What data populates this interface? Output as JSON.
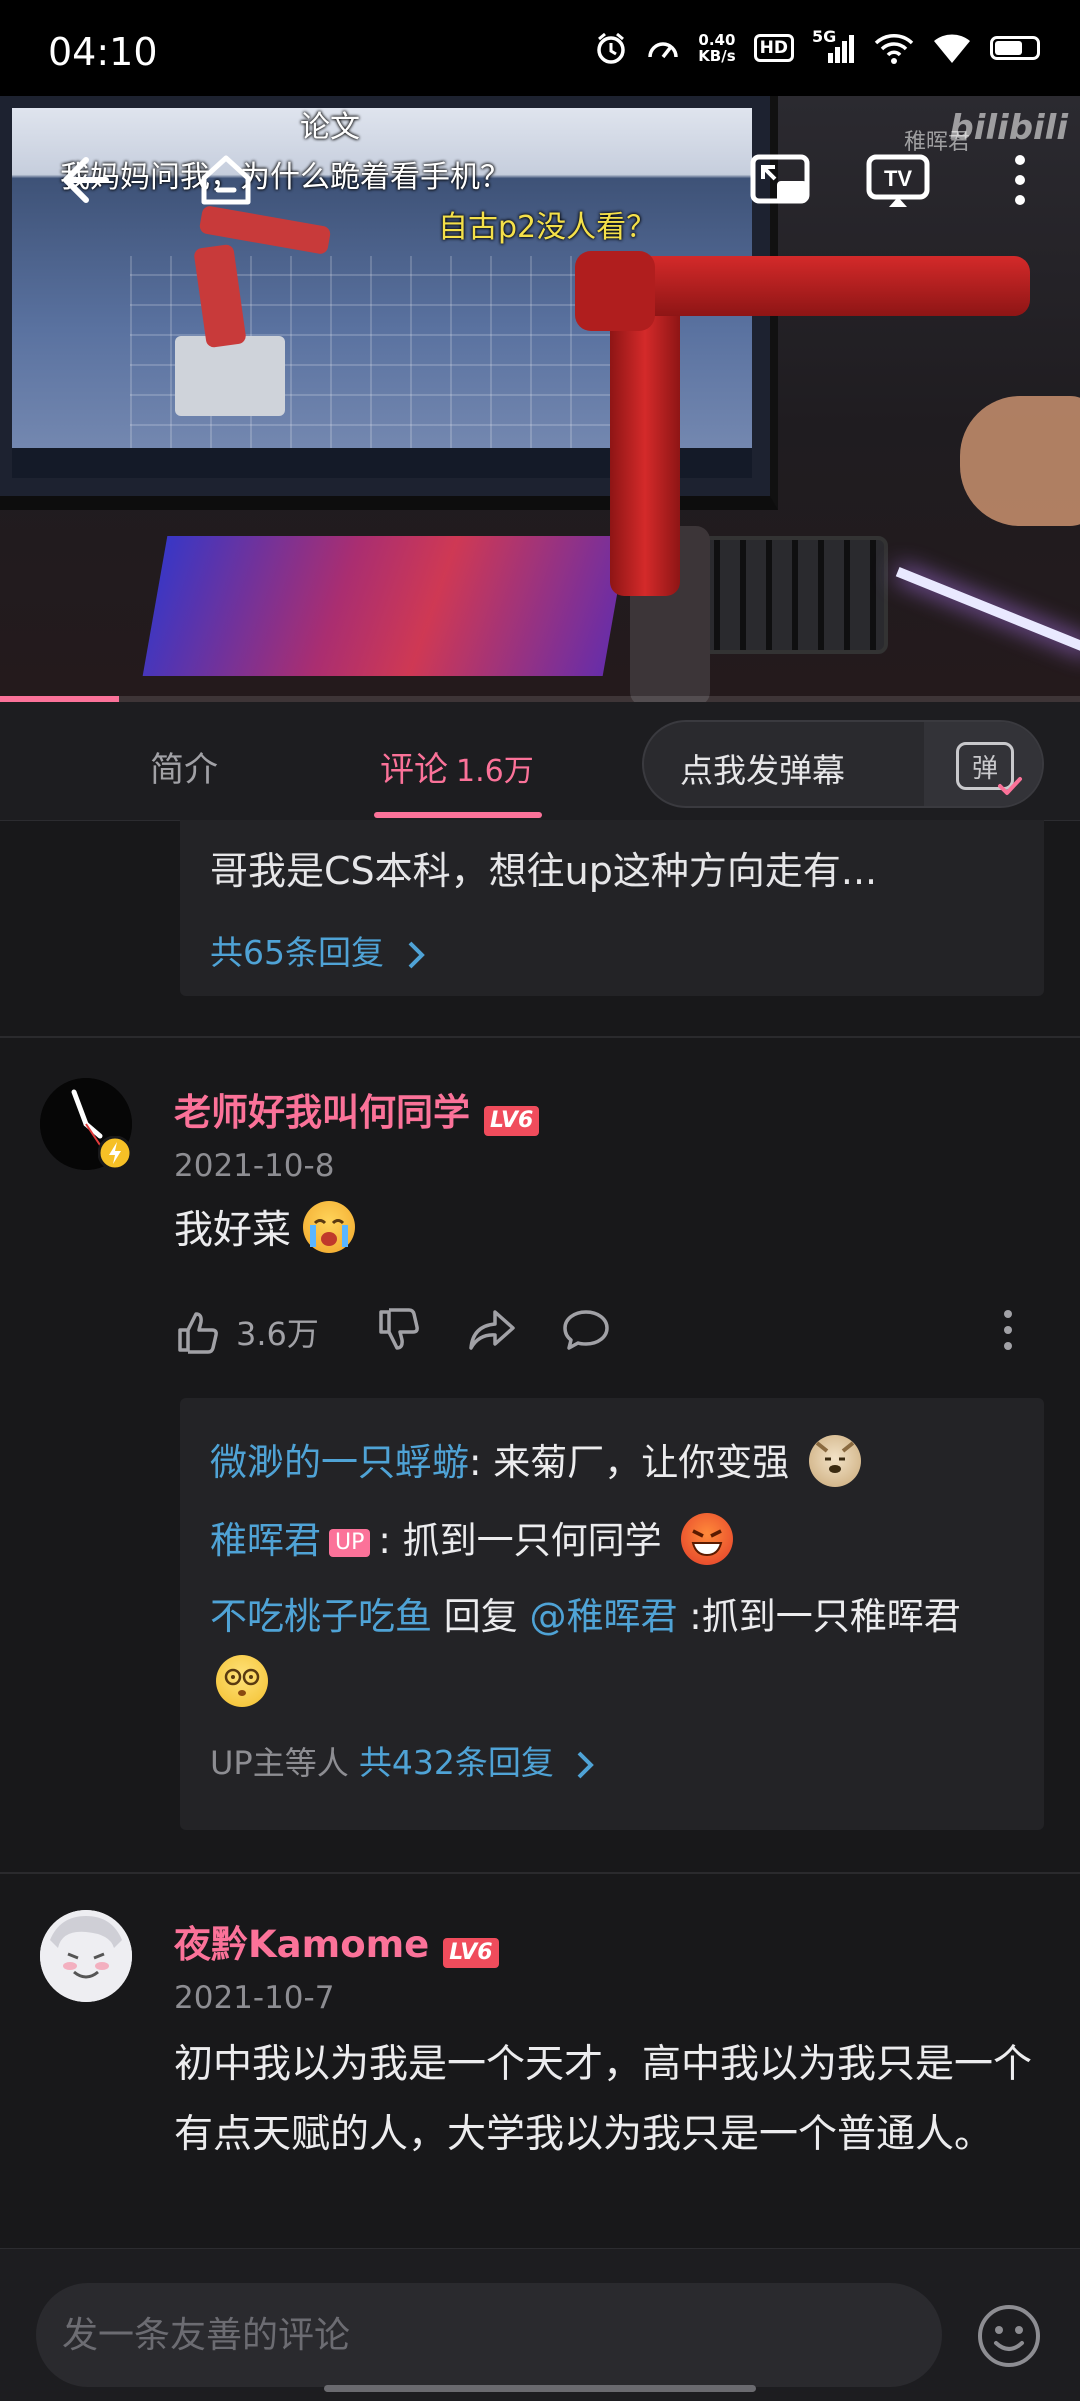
{
  "status_bar": {
    "time": "04:10",
    "net_speed_value": "0.40",
    "net_speed_unit": "KB/s",
    "hd": "HD",
    "network": "5G",
    "battery_level": 0.65
  },
  "video": {
    "watermark_text": "稚晖君",
    "watermark_logo": "bilibili",
    "danmaku": [
      {
        "text": "论文",
        "color": "#ffffff"
      },
      {
        "text": "我妈妈问我，为什么跪着看手机？",
        "color": "#ffffff"
      },
      {
        "text": "自古p2没人看？",
        "color": "#f4e04a"
      }
    ],
    "progress": 0.11,
    "icons": [
      "back-arrow-icon",
      "home-icon",
      "pip-icon",
      "tv-cast-icon",
      "more-vertical-icon"
    ]
  },
  "tabs": {
    "intro": "简介",
    "comments": "评论",
    "comments_count": "1.6万",
    "send_danmaku": "点我发弹幕",
    "danmaku_toggle": "弹"
  },
  "feed": {
    "prev_reply_snippet": "哥我是CS本科，想往up这种方向走有...",
    "prev_reply_more": "共65条回复",
    "comments": [
      {
        "username": "老师好我叫何同学",
        "level": "LV6",
        "date": "2021-10-8",
        "text": "我好菜",
        "likes": "3.6万",
        "replies": [
          {
            "name": "微渺的一只蜉蝣",
            "text": ": 来菊厂，让你变强"
          },
          {
            "name": "稚晖君",
            "badge": "UP",
            "text": ": 抓到一只何同学"
          },
          {
            "name": "不吃桃子吃鱼",
            "mid": " 回复 ",
            "mention": "@稚晖君",
            "text": " :抓到一只稚晖君"
          }
        ],
        "reply_summary_prefix": "UP主等人 ",
        "reply_summary_count": "共432条回复"
      },
      {
        "username": "夜黔Kamome",
        "level": "LV6",
        "date": "2021-10-7",
        "text": "初中我以为我是一个天才，高中我以为我只是一个有点天赋的人，大学我以为我只是一个普通人。"
      }
    ]
  },
  "bottom": {
    "comment_placeholder": "发一条友善的评论"
  },
  "colors": {
    "accent_pink": "#fb7299",
    "link_blue": "#4fa3d6",
    "level_red": "#f04c5c",
    "background": "#18181a"
  }
}
